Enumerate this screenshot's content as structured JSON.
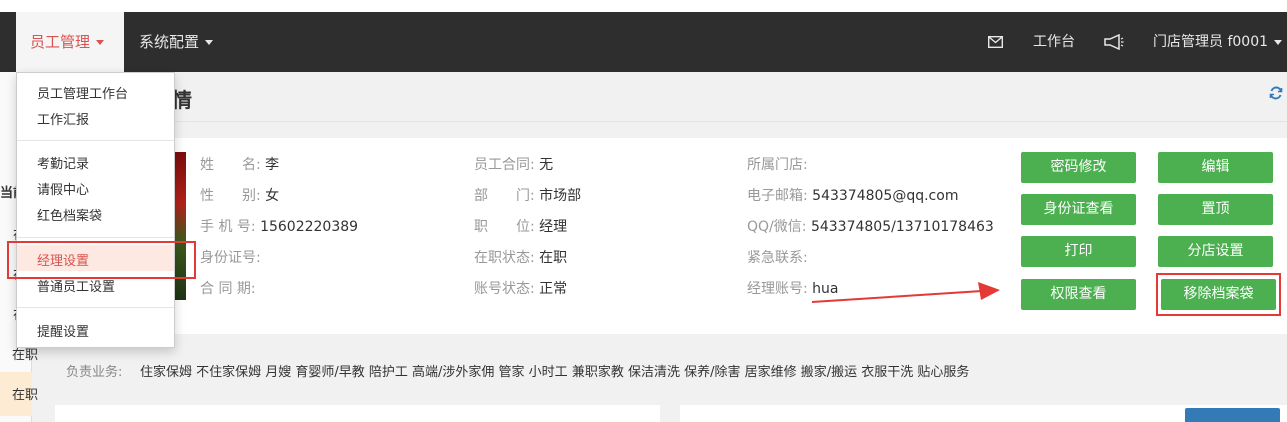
{
  "nav": {
    "menu_staff": "员工管理",
    "menu_system": "系统配置",
    "workbench": "工作台",
    "user": "门店管理员  f0001"
  },
  "dropdown": {
    "group1": [
      "员工管理工作台",
      "工作汇报"
    ],
    "group2": [
      "考勤记录",
      "请假中心",
      "红色档案袋"
    ],
    "group3": [
      "经理设置",
      "普通员工设置"
    ],
    "group4": [
      "提醒设置"
    ]
  },
  "sidebar": {
    "t1": "当前",
    "t2": "在",
    "t3": "在",
    "t4": "在",
    "t5": "在职",
    "t6": "在职"
  },
  "page": {
    "title": "情"
  },
  "profile": {
    "col1": [
      {
        "label": "姓　　名:",
        "value": "李"
      },
      {
        "label": "性　　别:",
        "value": "女"
      },
      {
        "label": "手 机 号:",
        "value": "15602220389"
      },
      {
        "label": "身份证号:",
        "value": ""
      },
      {
        "label": "合 同 期:",
        "value": ""
      }
    ],
    "col2": [
      {
        "label": "员工合同:",
        "value": "无"
      },
      {
        "label": "部　　门:",
        "value": "市场部"
      },
      {
        "label": "职　　位:",
        "value": "经理"
      },
      {
        "label": "在职状态:",
        "value": "在职"
      },
      {
        "label": "账号状态:",
        "value": "正常"
      }
    ],
    "col3": [
      {
        "label": "所属门店:",
        "value": ""
      },
      {
        "label": "电子邮箱:",
        "value": "543374805@qq.com"
      },
      {
        "label": "QQ/微信:",
        "value": "543374805/13710178463"
      },
      {
        "label": "紧急联系:",
        "value": ""
      },
      {
        "label": "经理账号:",
        "value": "hua"
      }
    ]
  },
  "buttons": {
    "change_password": "密码修改",
    "edit": "编辑",
    "view_id": "身份证查看",
    "pin_top": "置顶",
    "print": "打印",
    "branch_settings": "分店设置",
    "view_permissions": "权限查看",
    "remove_archive": "移除档案袋"
  },
  "business": {
    "label": "负责业务:",
    "value": "住家保姆 不住家保姆 月嫂 育婴师/早教 陪护工 高端/涉外家佣 管家 小时工 兼职家教 保洁清洗 保养/除害 居家维修 搬家/搬运 衣服干洗 贴心服务"
  },
  "colors": {
    "accent_green": "#4caf50",
    "annotation_red": "#e53935",
    "nav_bg": "#2e2e2e",
    "active_red": "#d9534f"
  }
}
